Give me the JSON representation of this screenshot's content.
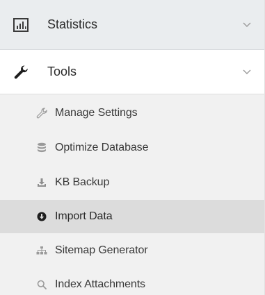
{
  "sections": {
    "statistics": {
      "label": "Statistics",
      "icon": "bar-chart-icon"
    },
    "tools": {
      "label": "Tools",
      "icon": "wrench-icon"
    }
  },
  "tools_items": [
    {
      "label": "Manage Settings",
      "icon": "wrench-icon",
      "active": false
    },
    {
      "label": "Optimize Database",
      "icon": "database-icon",
      "active": false
    },
    {
      "label": "KB Backup",
      "icon": "download-icon",
      "active": false
    },
    {
      "label": "Import Data",
      "icon": "arrow-circle-down-icon",
      "active": true
    },
    {
      "label": "Sitemap Generator",
      "icon": "sitemap-icon",
      "active": false
    },
    {
      "label": "Index Attachments",
      "icon": "search-icon",
      "active": false
    }
  ],
  "colors": {
    "section_bg": "#eaedef",
    "submenu_bg": "#f1f1f1",
    "active_bg": "#dcdcdc",
    "icon_gray": "#9a9a9a",
    "icon_dark": "#222222"
  }
}
